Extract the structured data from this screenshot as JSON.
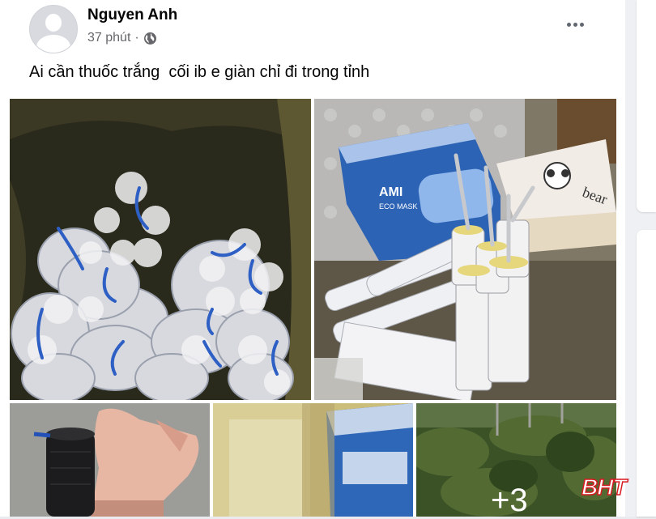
{
  "post": {
    "author": "Nguyen Anh",
    "time": "37 phút",
    "separator": "·",
    "privacy_icon": "globe-icon",
    "menu_icon": "more-options-icon",
    "text": "Ai cần thuốc trắng  cối ib e giàn chỉ đi trong tỉnh"
  },
  "photos": {
    "more_count": "+3",
    "box_label_1": "AMI",
    "box_label_2": "ECO MASK",
    "book_label": "bear"
  },
  "watermark": "BHT",
  "colors": {
    "watermark_red": "#d71a1f",
    "meta_gray": "#65676b",
    "box_blue": "#2d63b4"
  }
}
